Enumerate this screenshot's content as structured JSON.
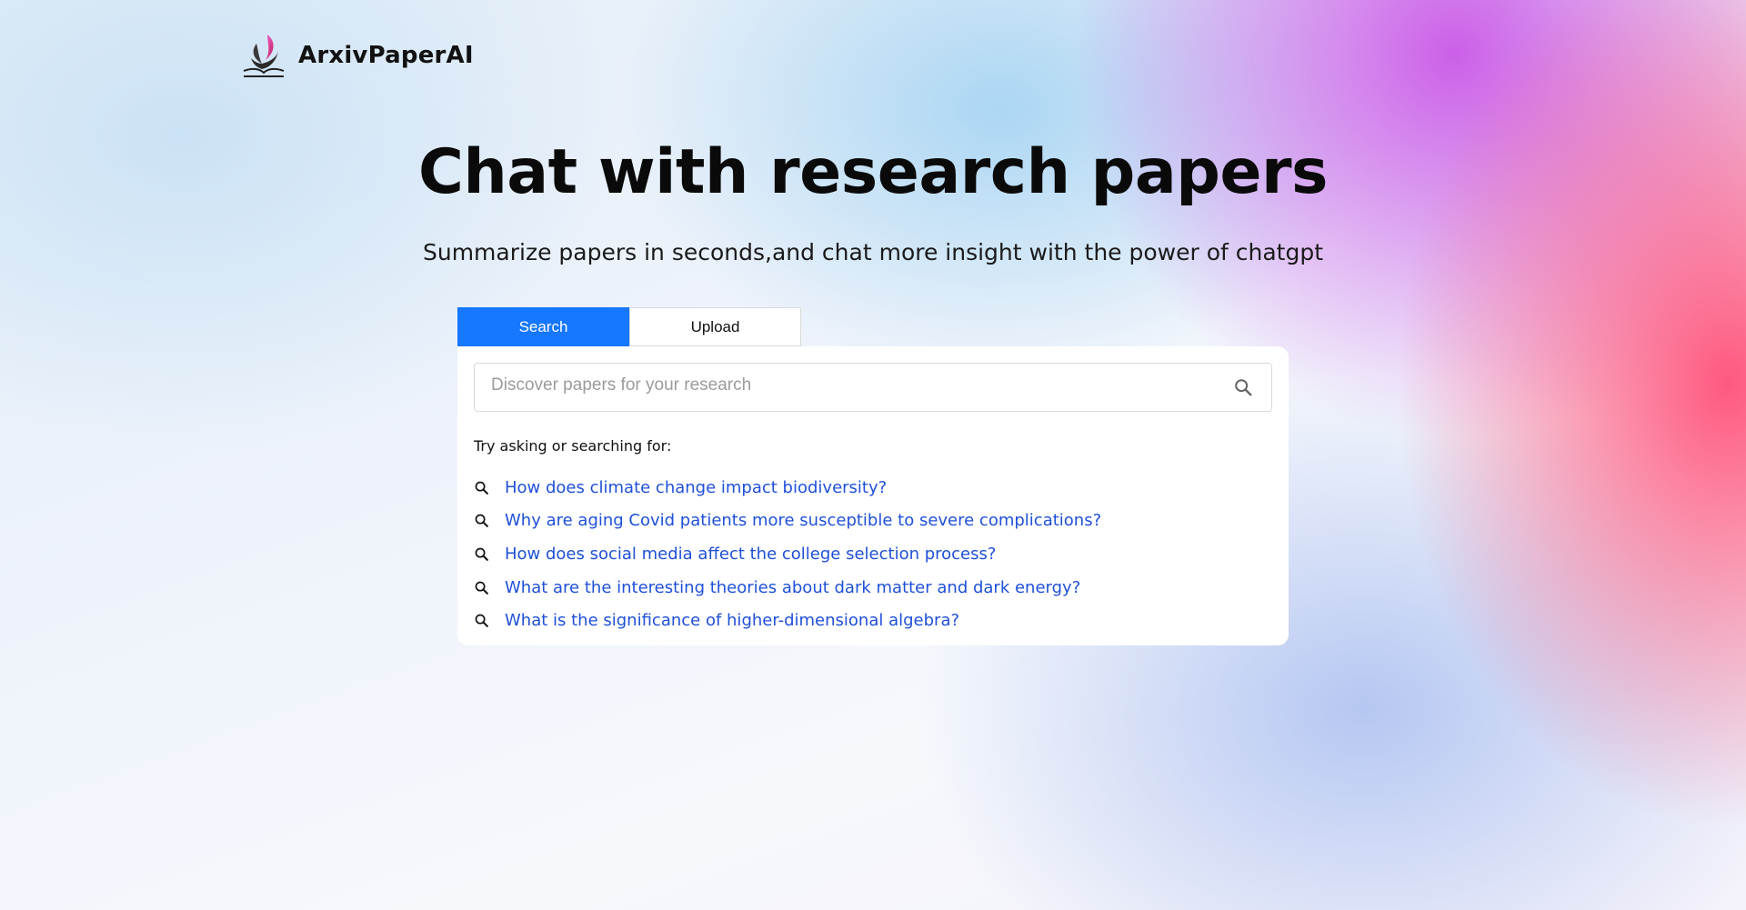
{
  "brand": {
    "name": "ArxivPaperAI",
    "logo_icon": "flame-book-logo-icon"
  },
  "hero": {
    "title": "Chat with research papers",
    "subtitle": "Summarize papers in seconds,and chat more insight with the power of chatgpt"
  },
  "tabs": [
    {
      "label": "Search",
      "active": true
    },
    {
      "label": "Upload",
      "active": false
    }
  ],
  "search": {
    "value": "",
    "placeholder": "Discover papers for your research",
    "icon": "search-icon"
  },
  "suggestions": {
    "label": "Try asking or searching for:",
    "icon": "search-icon",
    "items": [
      "How does climate change impact biodiversity?",
      "Why are aging Covid patients more susceptible to severe complications?",
      "How does social media affect the college selection process?",
      "What are the interesting theories about dark matter and dark energy?",
      "What is the significance of higher-dimensional algebra?"
    ]
  },
  "colors": {
    "accent": "#1677ff",
    "link": "#1f50d8",
    "text": "#111111"
  }
}
